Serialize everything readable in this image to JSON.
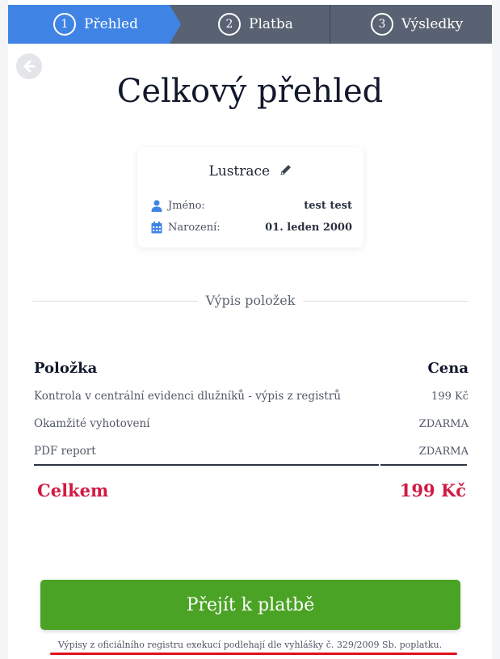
{
  "steps": [
    {
      "number": "1",
      "label": "Přehled",
      "active": true
    },
    {
      "number": "2",
      "label": "Platba",
      "active": false
    },
    {
      "number": "3",
      "label": "Výsledky",
      "active": false
    }
  ],
  "title": "Celkový přehled",
  "card": {
    "title": "Lustrace",
    "name_label": "Jméno:",
    "name_value": "test test",
    "birth_label": "Narození:",
    "birth_value": "01. leden 2000"
  },
  "divider_text": "Výpis položek",
  "table": {
    "col_item": "Položka",
    "col_price": "Cena",
    "rows": [
      {
        "item": "Kontrola v centrální evidenci dlužníků - výpis z registrů",
        "price": "199 Kč"
      },
      {
        "item": "Okamžité vyhotovení",
        "price": "ZDARMA"
      },
      {
        "item": "PDF report",
        "price": "ZDARMA"
      }
    ],
    "total_label": "Celkem",
    "total_value": "199 Kč"
  },
  "pay_button": "Přejít k platbě",
  "note": "Výpisy z oficiálního registru exekucí podlehají dle vyhlášky č. 329/2009 Sb. poplatku.",
  "colors": {
    "active_step": "#3f84e5",
    "inactive_step": "#586272",
    "total": "#d11a42",
    "button": "#4ba325",
    "underline": "#e1121e"
  },
  "icons": {
    "back": "arrow-left-icon",
    "edit": "pencil-icon",
    "name": "user-icon",
    "birth": "calendar-icon"
  }
}
